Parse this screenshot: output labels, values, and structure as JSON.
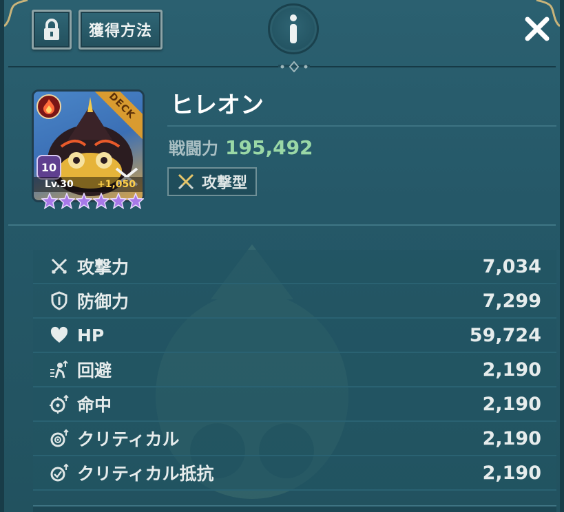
{
  "header": {
    "acquire_label": "獲得方法",
    "info_glyph": "i",
    "close_glyph": "✕"
  },
  "character": {
    "name": "ヒレオン",
    "power_label": "戦闘力",
    "power_value": "195,492",
    "type_label": "攻撃型",
    "deck_label": "DECK",
    "level_badge": "10",
    "level_text": "Lv.30",
    "bonus_text": "+1,050",
    "stars": 6,
    "element": "fire-icon"
  },
  "stats": [
    {
      "icon": "sword-icon",
      "label": "攻撃力",
      "value": "7,034"
    },
    {
      "icon": "shield-icon",
      "label": "防御力",
      "value": "7,299"
    },
    {
      "icon": "heart-icon",
      "label": "HP",
      "value": "59,724"
    },
    {
      "icon": "evasion-icon",
      "label": "回避",
      "value": "2,190"
    },
    {
      "icon": "accuracy-icon",
      "label": "命中",
      "value": "2,190"
    },
    {
      "icon": "critical-icon",
      "label": "クリティカル",
      "value": "2,190"
    },
    {
      "icon": "critical-resist-icon",
      "label": "クリティカル抵抗",
      "value": "2,190"
    }
  ],
  "colors": {
    "panel": "#255868",
    "power_value": "#9ad8a6",
    "text": "#e6ecec"
  }
}
